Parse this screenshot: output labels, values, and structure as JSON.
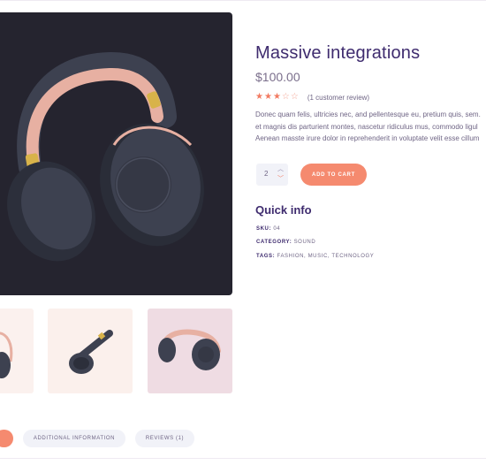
{
  "product": {
    "title": "Massive integrations",
    "price": "$100.00",
    "rating": {
      "value": 3,
      "max": 5
    },
    "review_link": "(1 customer review)",
    "description_lines": [
      "Donec quam felis, ultricies nec, and pellentesque eu, pretium quis, sem.",
      "et magnis dis parturient montes, nascetur ridiculus mus, commodo ligul",
      "Aenean masste irure dolor in reprehenderit in voluptate velit esse cillum"
    ],
    "quantity": "2",
    "add_to_cart_label": "ADD TO CART"
  },
  "quick_info": {
    "title": "Quick info",
    "sku_label": "SKU:",
    "sku_value": "04",
    "category_label": "CATEGORY:",
    "category_value": "SOUND",
    "tags_label": "TAGS:",
    "tags_value": "FASHION, MUSIC, TECHNOLOGY"
  },
  "tabs": [
    {
      "label": ""
    },
    {
      "label": "ADDITIONAL INFORMATION"
    },
    {
      "label": "REVIEWS (1)"
    }
  ],
  "icons": {
    "star": "star-icon",
    "qty_up": "chevron-up-icon",
    "qty_down": "chevron-down-icon"
  },
  "colors": {
    "accent": "#f58a6f",
    "heading": "#3e2b6e",
    "image_background": "#25242f",
    "headphone_body": "#3d4150",
    "headband": "#e7b0a2",
    "hinge": "#d8b34a"
  }
}
